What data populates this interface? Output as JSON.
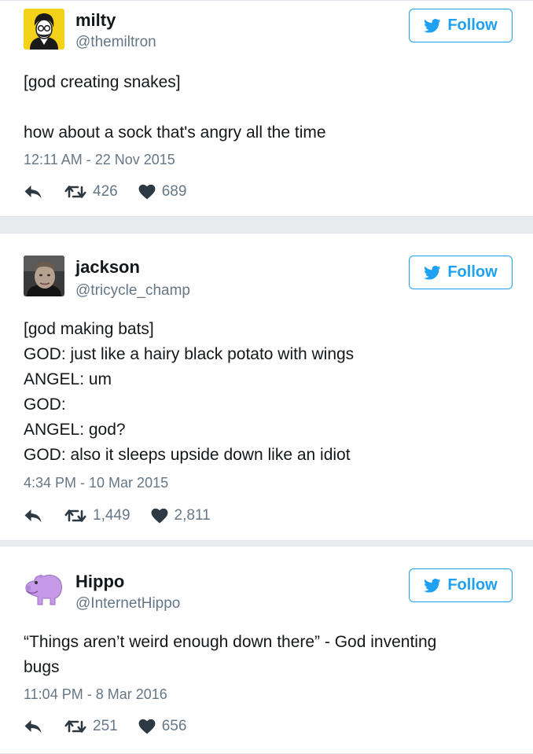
{
  "tweets": [
    {
      "name": "milty",
      "handle": "@themiltron",
      "follow_label": "Follow",
      "lines": [
        "[god creating snakes]",
        "",
        "how about a sock that's angry all the time"
      ],
      "time": "12:11 AM - 22 Nov 2015",
      "retweets": "426",
      "likes": "689"
    },
    {
      "name": "jackson",
      "handle": "@tricycle_champ",
      "follow_label": "Follow",
      "lines": [
        "[god making bats]",
        "GOD: just like a hairy black potato with wings",
        "ANGEL: um",
        "GOD:",
        "ANGEL: god?",
        "GOD: also it sleeps upside down like an idiot"
      ],
      "time": "4:34 PM - 10 Mar 2015",
      "retweets": "1,449",
      "likes": "2,811"
    },
    {
      "name": "Hippo",
      "handle": "@InternetHippo",
      "follow_label": "Follow",
      "lines": [
        "“Things aren’t weird enough down there” - God inventing",
        "bugs"
      ],
      "time": "11:04 PM - 8 Mar 2016",
      "retweets": "251",
      "likes": "656"
    }
  ],
  "colors": {
    "accent": "#1da1f2",
    "muted": "#657786",
    "icon": "#2d3a44"
  }
}
